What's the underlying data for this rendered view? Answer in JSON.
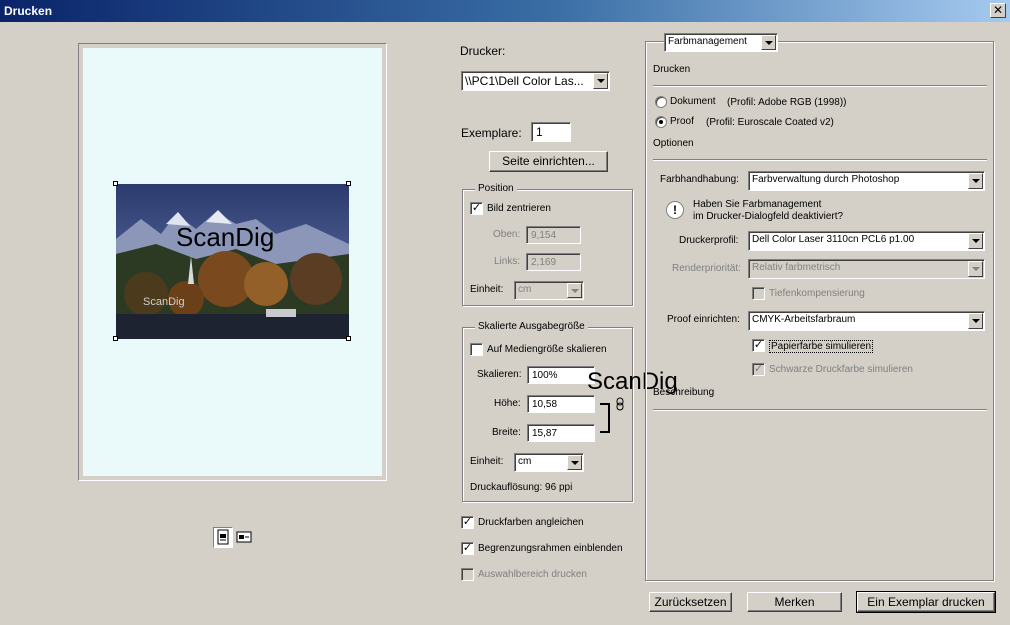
{
  "window": {
    "title": "Drucken",
    "close_glyph": "✕"
  },
  "preview": {
    "watermark_large": "ScanDig",
    "watermark_small": "ScanDig",
    "colors": {
      "sky": "#3b4a7a",
      "paper": "#eafafa"
    }
  },
  "printer": {
    "label": "Drucker:",
    "selected": "\\\\PC1\\Dell Color Las...",
    "copies_label": "Exemplare:",
    "copies_value": "1",
    "page_setup_button": "Seite einrichten..."
  },
  "position": {
    "title": "Position",
    "center_label": "Bild zentrieren",
    "center_checked": true,
    "top_label": "Oben:",
    "top_value": "9,154",
    "left_label": "Links:",
    "left_value": "2,169",
    "unit_label": "Einheit:",
    "unit_value": "cm"
  },
  "scaled": {
    "title": "Skalierte Ausgabegröße",
    "fit_media_label": "Auf Mediengröße skalieren",
    "fit_media_checked": false,
    "scale_label": "Skalieren:",
    "scale_value": "100%",
    "height_label": "Höhe:",
    "height_value": "10,58",
    "width_label": "Breite:",
    "width_value": "15,87",
    "unit_label": "Einheit:",
    "unit_value": "cm",
    "resolution": "Druckauflösung: 96 ppi",
    "overlay_watermark": "ScanDig"
  },
  "bottom_options": [
    {
      "label": "Druckfarben angleichen",
      "checked": true,
      "disabled": false
    },
    {
      "label": "Begrenzungsrahmen einblenden",
      "checked": true,
      "disabled": false
    },
    {
      "label": "Auswahlbereich drucken",
      "checked": false,
      "disabled": true
    }
  ],
  "color_management": {
    "dropdown": "Farbmanagement",
    "print_heading": "Drucken",
    "doc_option": "Dokument",
    "doc_profile": "(Profil: Adobe RGB (1998))",
    "proof_option": "Proof",
    "proof_profile": "(Profil: Euroscale Coated v2)",
    "selected_option": "proof",
    "options_heading": "Optionen",
    "handling_label": "Farbhandhabung:",
    "handling_value": "Farbverwaltung durch Photoshop",
    "warning_text_1": "Haben Sie Farbmanagement",
    "warning_text_2": "im Drucker-Dialogfeld deaktiviert?",
    "printer_profile_label": "Druckerprofil:",
    "printer_profile_value": "Dell Color Laser 3110cn PCL6 p1.00",
    "intent_label": "Renderpriorität:",
    "intent_value": "Relativ farbmetrisch",
    "bpc_label": "Tiefenkompensierung",
    "proof_setup_label": "Proof einrichten:",
    "proof_setup_value": "CMYK-Arbeitsfarbraum",
    "paper_color_label": "Papierfarbe simulieren",
    "black_ink_label": "Schwarze Druckfarbe simulieren",
    "description_heading": "Beschreibung"
  },
  "footer": {
    "reset": "Zurücksetzen",
    "remember": "Merken",
    "print_one": "Ein Exemplar drucken"
  }
}
